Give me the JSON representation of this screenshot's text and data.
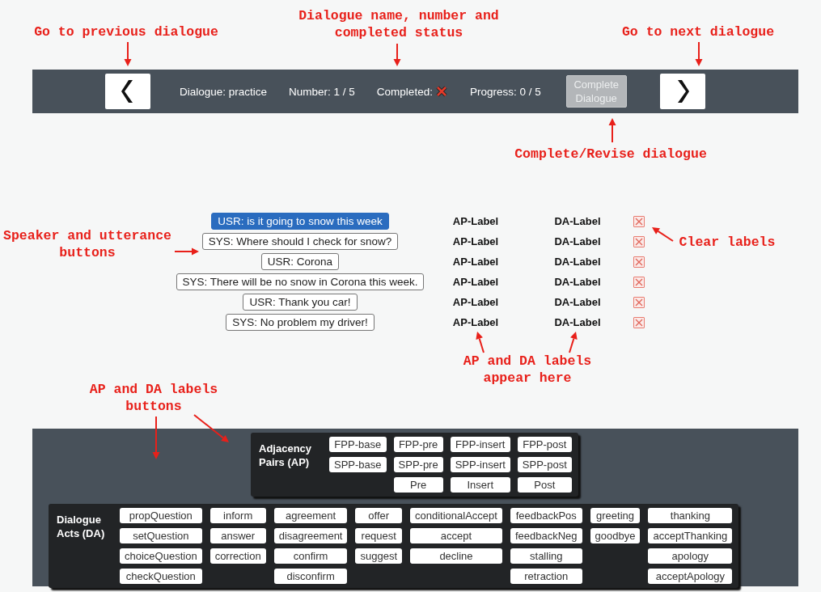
{
  "annotations": [
    {
      "text": "Go to previous dialogue"
    },
    {
      "text": "Dialogue name, number and completed status"
    },
    {
      "text": "Go to next dialogue"
    },
    {
      "text": "Complete/Revise dialogue"
    },
    {
      "text": "Speaker and utterance buttons"
    },
    {
      "text": "Clear labels"
    },
    {
      "text": "AP and DA labels appear here"
    },
    {
      "text": "AP and DA labels buttons"
    }
  ],
  "dialogue_bar": {
    "dialogue": "Dialogue: practice",
    "number": "Number: 1 / 5",
    "completed_label": "Completed:",
    "completed": false,
    "progress": "Progress: 0 / 5",
    "complete_button": {
      "label": "Complete Dialogue",
      "disabled": true
    }
  },
  "utterances": [
    {
      "text": "USR: is it going to snow this week",
      "selected": true,
      "ap_label": "AP-Label",
      "da_label": "DA-Label"
    },
    {
      "text": "SYS: Where should I check for snow?",
      "selected": false,
      "ap_label": "AP-Label",
      "da_label": "DA-Label"
    },
    {
      "text": "USR: Corona",
      "selected": false,
      "ap_label": "AP-Label",
      "da_label": "DA-Label"
    },
    {
      "text": "SYS: There will be no snow in Corona this week.",
      "selected": false,
      "ap_label": "AP-Label",
      "da_label": "DA-Label"
    },
    {
      "text": "USR: Thank you car!",
      "selected": false,
      "ap_label": "AP-Label",
      "da_label": "DA-Label"
    },
    {
      "text": "SYS: No problem my driver!",
      "selected": false,
      "ap_label": "AP-Label",
      "da_label": "DA-Label"
    }
  ],
  "adjacency_pairs": {
    "title": "Adjacency Pairs (AP)",
    "columns": [
      [
        "FPP-base",
        "SPP-base"
      ],
      [
        "FPP-pre",
        "SPP-pre",
        "Pre"
      ],
      [
        "FPP-insert",
        "SPP-insert",
        "Insert"
      ],
      [
        "FPP-post",
        "SPP-post",
        "Post"
      ]
    ]
  },
  "dialogue_acts": {
    "title": "Dialogue Acts (DA)",
    "columns": [
      [
        "propQuestion",
        "setQuestion",
        "choiceQuestion",
        "checkQuestion"
      ],
      [
        "inform",
        "answer",
        "correction"
      ],
      [
        "agreement",
        "disagreement",
        "confirm",
        "disconfirm"
      ],
      [
        "offer",
        "request",
        "suggest"
      ],
      [
        "conditionalAccept",
        "accept",
        "decline"
      ],
      [
        "feedbackPos",
        "feedbackNeg",
        "stalling",
        "retraction"
      ],
      [
        "greeting",
        "goodbye"
      ],
      [
        "thanking",
        "acceptThanking",
        "apology",
        "acceptApology"
      ]
    ]
  }
}
